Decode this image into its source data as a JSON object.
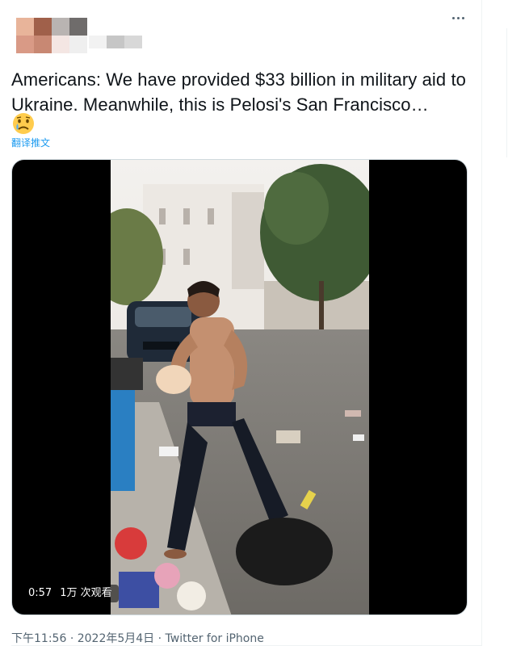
{
  "tweet": {
    "text": "Americans: We have provided $33 billion in military aid to Ukraine. Meanwhile, this is Pelosi's San Francisco…",
    "emoji": "crying-face",
    "translate_label": "翻译推文",
    "more_icon": "more-dots-icon"
  },
  "video": {
    "duration": "0:57",
    "views": "1万 次观看"
  },
  "meta": {
    "time": "下午11:56",
    "date": "2022年5月4日",
    "separator": "·",
    "source": "Twitter for iPhone"
  },
  "colors": {
    "link": "#1d9bf0",
    "muted": "#536471",
    "text": "#0f1419"
  }
}
